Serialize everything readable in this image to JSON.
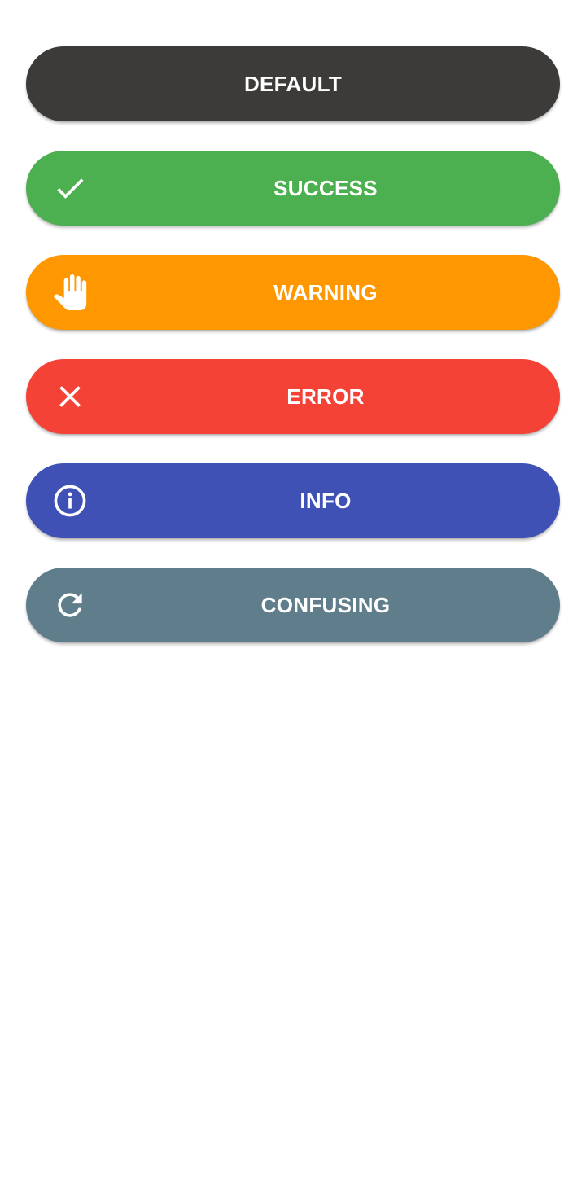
{
  "buttons": {
    "default": {
      "label": "DEFAULT",
      "color": "#3c3b3a"
    },
    "success": {
      "label": "SUCCESS",
      "color": "#4caf50",
      "icon": "check-icon"
    },
    "warning": {
      "label": "WARNING",
      "color": "#ff9800",
      "icon": "hand-icon"
    },
    "error": {
      "label": "ERROR",
      "color": "#f44336",
      "icon": "close-icon"
    },
    "info": {
      "label": "INFO",
      "color": "#3f51b5",
      "icon": "info-icon"
    },
    "confusing": {
      "label": "CONFUSING",
      "color": "#607d8b",
      "icon": "refresh-icon"
    }
  }
}
